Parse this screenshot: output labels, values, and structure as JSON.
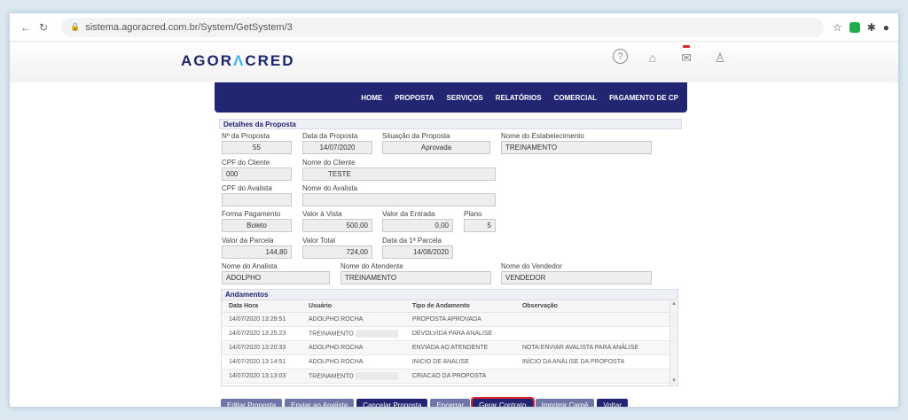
{
  "browser": {
    "url": "sistema.agoracred.com.br/System/GetSystem/3"
  },
  "header": {
    "logo_text_1": "AGOR",
    "logo_accent": "Λ",
    "logo_text_2": "CRED",
    "help_glyph": "?"
  },
  "nav": [
    "HOME",
    "PROPOSTA",
    "SERVIÇOS",
    "RELATÓRIOS",
    "COMERCIAL",
    "PAGAMENTO DE CP"
  ],
  "details": {
    "title": "Detalhes da Proposta",
    "labels": {
      "numero": "Nº da Proposta",
      "data": "Data da Proposta",
      "situacao": "Situação da Proposta",
      "estabelecimento": "Nome do Estabelecimento",
      "cpf_cliente": "CPF do Cliente",
      "nome_cliente": "Nome do Cliente",
      "cpf_avalista": "CPF do Avalista",
      "nome_avalista": "Nome do Avalista",
      "forma_pagamento": "Forma Pagamento",
      "valor_vista": "Valor à Vista",
      "valor_entrada": "Valor da Entrada",
      "plano": "Plano",
      "valor_parcela": "Valor da Parcela",
      "valor_total": "Valor Total",
      "data_primeira": "Data da 1ª Parcela",
      "analista": "Nome do Analista",
      "atendente": "Nome do Atendente",
      "vendedor": "Nome do Vendedor"
    },
    "values": {
      "numero": "55",
      "data": "14/07/2020",
      "situacao": "Aprovada",
      "estabelecimento": "TREINAMENTO",
      "cpf_cliente": "000",
      "nome_cliente": "TESTE",
      "cpf_avalista": "",
      "nome_avalista": "",
      "forma_pagamento": "Boleto",
      "valor_vista": "500,00",
      "valor_entrada": "0,00",
      "plano": "5",
      "valor_parcela": "144,80",
      "valor_total": "724,00",
      "data_primeira": "14/08/2020",
      "analista": "ADOLPHO",
      "atendente": "TREINAMENTO",
      "vendedor": "VENDEDOR"
    }
  },
  "andamentos": {
    "title": "Andamentos",
    "columns": [
      "Data Hora",
      "Usuário",
      "Tipo de Andamento",
      "Observação"
    ],
    "rows": [
      {
        "datahora": "14/07/2020 13:29:51",
        "usuario": "ADOLPHO.ROCHA",
        "tipo": "PROPOSTA APROVADA",
        "obs": ""
      },
      {
        "datahora": "14/07/2020 13:25:23",
        "usuario": "TREINAMENTO",
        "tipo": "DEVOLVIDA PARA ANALISE",
        "obs": ""
      },
      {
        "datahora": "14/07/2020 13:20:33",
        "usuario": "ADOLPHO.ROCHA",
        "tipo": "ENVIADA AO ATENDENTE",
        "obs": "NOTA:ENVIAR AVALISTA PARA ANÁLISE"
      },
      {
        "datahora": "14/07/2020 13:14:51",
        "usuario": "ADOLPHO.ROCHA",
        "tipo": "INICIO DE ANALISE",
        "obs": "INÍCIO DA ANÁLISE DA PROPOSTA"
      },
      {
        "datahora": "14/07/2020 13:13:03",
        "usuario": "TREINAMENTO",
        "tipo": "CRIACAO DA PROPOSTA",
        "obs": ""
      }
    ]
  },
  "buttons": {
    "editar": "Editar Proposta",
    "enviar": "Enviar ao Analista",
    "cancelar": "Cancelar Proposta",
    "encerrar": "Encerrar",
    "gerar": "Gerar Contrato",
    "imprimir": "Imprimir Carnê",
    "voltar": "Voltar"
  },
  "colors": {
    "brand_navy": "#222672",
    "accent_blue": "#38b6e8",
    "highlight_red": "#d8262c"
  }
}
